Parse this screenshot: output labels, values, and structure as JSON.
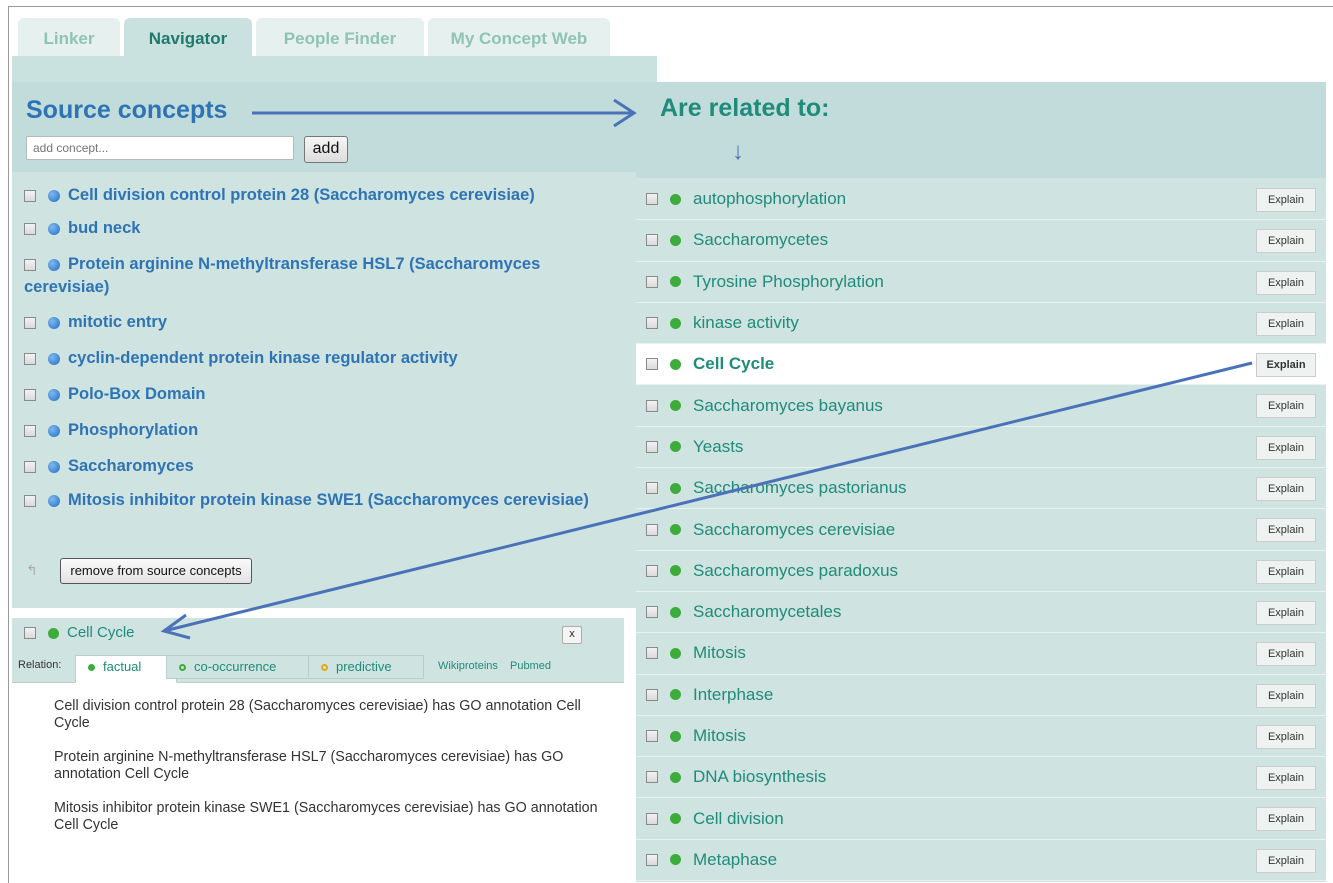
{
  "tabs": [
    {
      "label": "Linker",
      "active": false
    },
    {
      "label": "Navigator",
      "active": true
    },
    {
      "label": "People Finder",
      "active": false
    },
    {
      "label": "My Concept Web",
      "active": false
    }
  ],
  "source": {
    "title": "Source concepts",
    "add_placeholder": "add concept...",
    "add_label": "add",
    "items": [
      "Cell division control protein 28 (Saccharomyces cerevisiae)",
      "bud neck",
      "Protein arginine N-methyltransferase HSL7 (Saccharomyces cerevisiae)",
      "mitotic entry",
      "cyclin-dependent protein kinase regulator activity",
      "Polo-Box Domain",
      "Phosphorylation",
      "Saccharomyces",
      "Mitosis inhibitor protein kinase SWE1 (Saccharomyces cerevisiae)"
    ],
    "remove_label": "remove from source concepts"
  },
  "related": {
    "title": "Are related to:",
    "explain_label": "Explain",
    "items": [
      "autophosphorylation",
      "Saccharomycetes",
      "Tyrosine Phosphorylation",
      "kinase activity",
      "Cell Cycle",
      "Saccharomyces bayanus",
      "Yeasts",
      "Saccharomyces pastorianus",
      "Saccharomyces cerevisiae",
      "Saccharomyces paradoxus",
      "Saccharomycetales",
      "Mitosis",
      "Interphase",
      "Mitosis",
      "DNA biosynthesis",
      "Cell division",
      "Metaphase"
    ],
    "highlighted": "Cell Cycle"
  },
  "detail": {
    "title": "Cell Cycle",
    "close_label": "x",
    "relation_label": "Relation:",
    "relation_tabs": [
      "factual",
      "co-occurrence",
      "predictive"
    ],
    "links": [
      "Wikiproteins",
      "Pubmed"
    ],
    "explanations": [
      "Cell division control protein 28 (Saccharomyces cerevisiae) has GO annotation Cell Cycle",
      "Protein arginine N-methyltransferase HSL7 (Saccharomyces cerevisiae) has GO annotation Cell Cycle",
      "Mitosis inhibitor protein kinase SWE1 (Saccharomyces cerevisiae) has GO annotation Cell Cycle"
    ]
  },
  "colors": {
    "panel": "#cfe3e1",
    "source_text": "#2e74b5",
    "related_text": "#1f8b7a",
    "green_dot": "#3eac3c",
    "arrow": "#4a72b8"
  }
}
